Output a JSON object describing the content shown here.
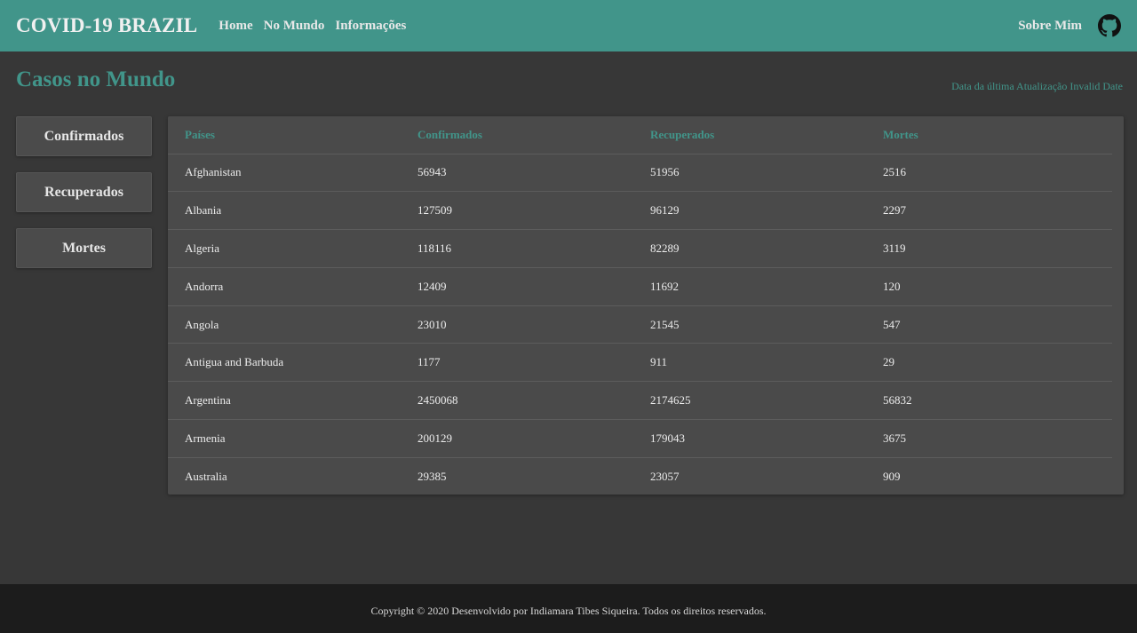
{
  "navbar": {
    "brand": "COVID-19 BRAZIL",
    "links": [
      "Home",
      "No Mundo",
      "Informações"
    ],
    "about": "Sobre Mim",
    "icon": "github-icon"
  },
  "page": {
    "title": "Casos no Mundo",
    "update_label": "Data da última Atualização Invalid Date"
  },
  "side_menu": [
    "Confirmados",
    "Recuperados",
    "Mortes"
  ],
  "table": {
    "headers": [
      "Países",
      "Confirmados",
      "Recuperados",
      "Mortes"
    ],
    "rows": [
      [
        "Afghanistan",
        "56943",
        "51956",
        "2516"
      ],
      [
        "Albania",
        "127509",
        "96129",
        "2297"
      ],
      [
        "Algeria",
        "118116",
        "82289",
        "3119"
      ],
      [
        "Andorra",
        "12409",
        "11692",
        "120"
      ],
      [
        "Angola",
        "23010",
        "21545",
        "547"
      ],
      [
        "Antigua and Barbuda",
        "1177",
        "911",
        "29"
      ],
      [
        "Argentina",
        "2450068",
        "2174625",
        "56832"
      ],
      [
        "Armenia",
        "200129",
        "179043",
        "3675"
      ],
      [
        "Australia",
        "29385",
        "23057",
        "909"
      ]
    ]
  },
  "footer": {
    "text": "Copyright © 2020 Desenvolvido por Indiamara Tibes Siqueira. Todos os direitos reservados."
  },
  "colors": {
    "accent": "#41958a",
    "background": "#373737",
    "card": "#4a4a4a",
    "footer": "#1c1c1c"
  }
}
